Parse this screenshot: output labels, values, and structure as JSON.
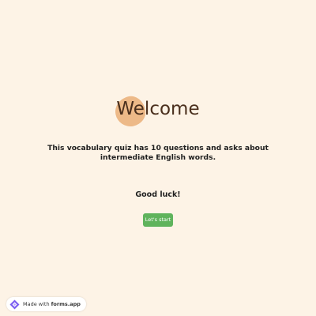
{
  "welcome": {
    "title": "Welcome",
    "description": "This vocabulary quiz has 10 questions and asks about intermediate English words.",
    "closing": "Good luck!",
    "start_label": "Let's start"
  },
  "badge": {
    "prefix": "Made with",
    "brand": "forms.app",
    "icon": "forms-app-logo-icon"
  },
  "colors": {
    "background": "#fdf3e6",
    "accent_blob": "#edb988",
    "button": "#5fb35c",
    "title_text": "#4a2f1d"
  }
}
